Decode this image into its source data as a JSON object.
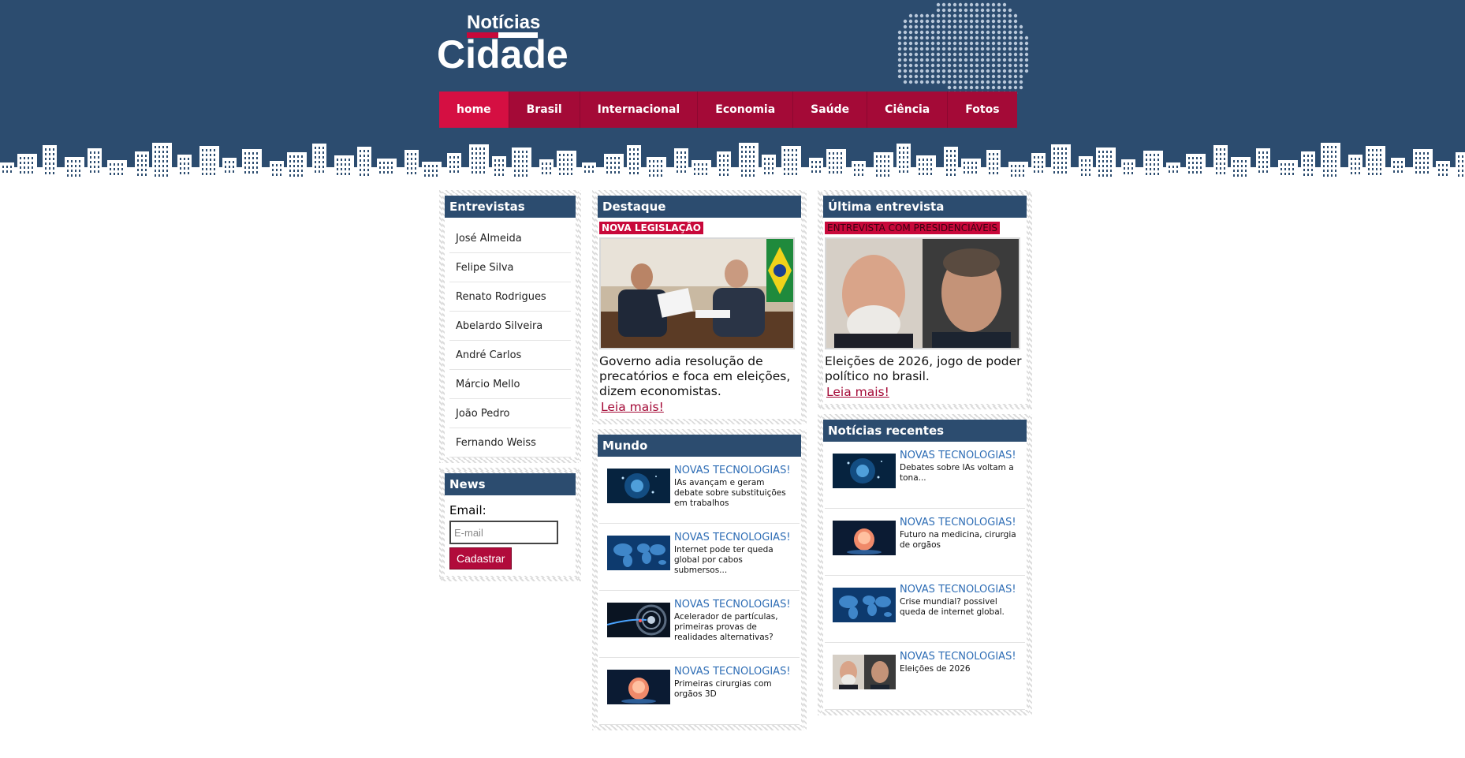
{
  "logo": {
    "small": "Notícias",
    "big": "Cidade"
  },
  "nav": [
    "home",
    "Brasil",
    "Internacional",
    "Economia",
    "Saúde",
    "Ciência",
    "Fotos"
  ],
  "entrevistas": {
    "title": "Entrevistas",
    "items": [
      "José Almeida",
      "Felipe Silva",
      "Renato Rodrigues",
      "Abelardo Silveira",
      "André Carlos",
      "Márcio Mello",
      "João Pedro",
      "Fernando Weiss"
    ]
  },
  "news": {
    "title": "News",
    "label": "Email:",
    "placeholder": "E-mail",
    "button": "Cadastrar"
  },
  "destaque": {
    "title": "Destaque",
    "tag": "NOVA LEGISLAÇÃO",
    "text": "Governo adia resolução de precatórios e foca em eleições, dizem economistas.",
    "link": "Leia mais!"
  },
  "mundo": {
    "title": "Mundo",
    "items": [
      {
        "head": "NOVAS TECNOLOGIAS!",
        "desc": "IAs avançam e geram debate sobre substituições em trabalhos",
        "thumb": "ai-network"
      },
      {
        "head": "NOVAS TECNOLOGIAS!",
        "desc": "Internet pode ter queda global por cabos submersos...",
        "thumb": "world-map"
      },
      {
        "head": "NOVAS TECNOLOGIAS!",
        "desc": "Acelerador de partículas, primeiras provas de realidades alternativas?",
        "thumb": "particle-tunnel"
      },
      {
        "head": "NOVAS TECNOLOGIAS!",
        "desc": "Primeiras cirurgias com orgãos 3D",
        "thumb": "3d-organ"
      }
    ]
  },
  "ultima": {
    "title": "Última entrevista",
    "tag": "ENTREVISTA COM PRESIDENCIÁVEIS",
    "text": "Eleições de 2026, jogo de poder político no brasil.",
    "link": "Leia mais!"
  },
  "recentes": {
    "title": "Notícias recentes",
    "items": [
      {
        "head": "NOVAS TECNOLOGIAS!",
        "desc": "Debates sobre IAs voltam a tona...",
        "thumb": "ai-network"
      },
      {
        "head": "NOVAS TECNOLOGIAS!",
        "desc": "Futuro na medicina, cirurgia de orgãos",
        "thumb": "3d-organ"
      },
      {
        "head": "NOVAS TECNOLOGIAS!",
        "desc": "Crise mundial? possivel queda de internet global.",
        "thumb": "world-map"
      },
      {
        "head": "NOVAS TECNOLOGIAS!",
        "desc": "Eleições de 2026",
        "thumb": "two-portraits"
      }
    ]
  },
  "colors": {
    "navy": "#2c4c6f",
    "crimson": "#a40a37",
    "active": "#d50f42",
    "link_blue": "#2e6db5"
  }
}
